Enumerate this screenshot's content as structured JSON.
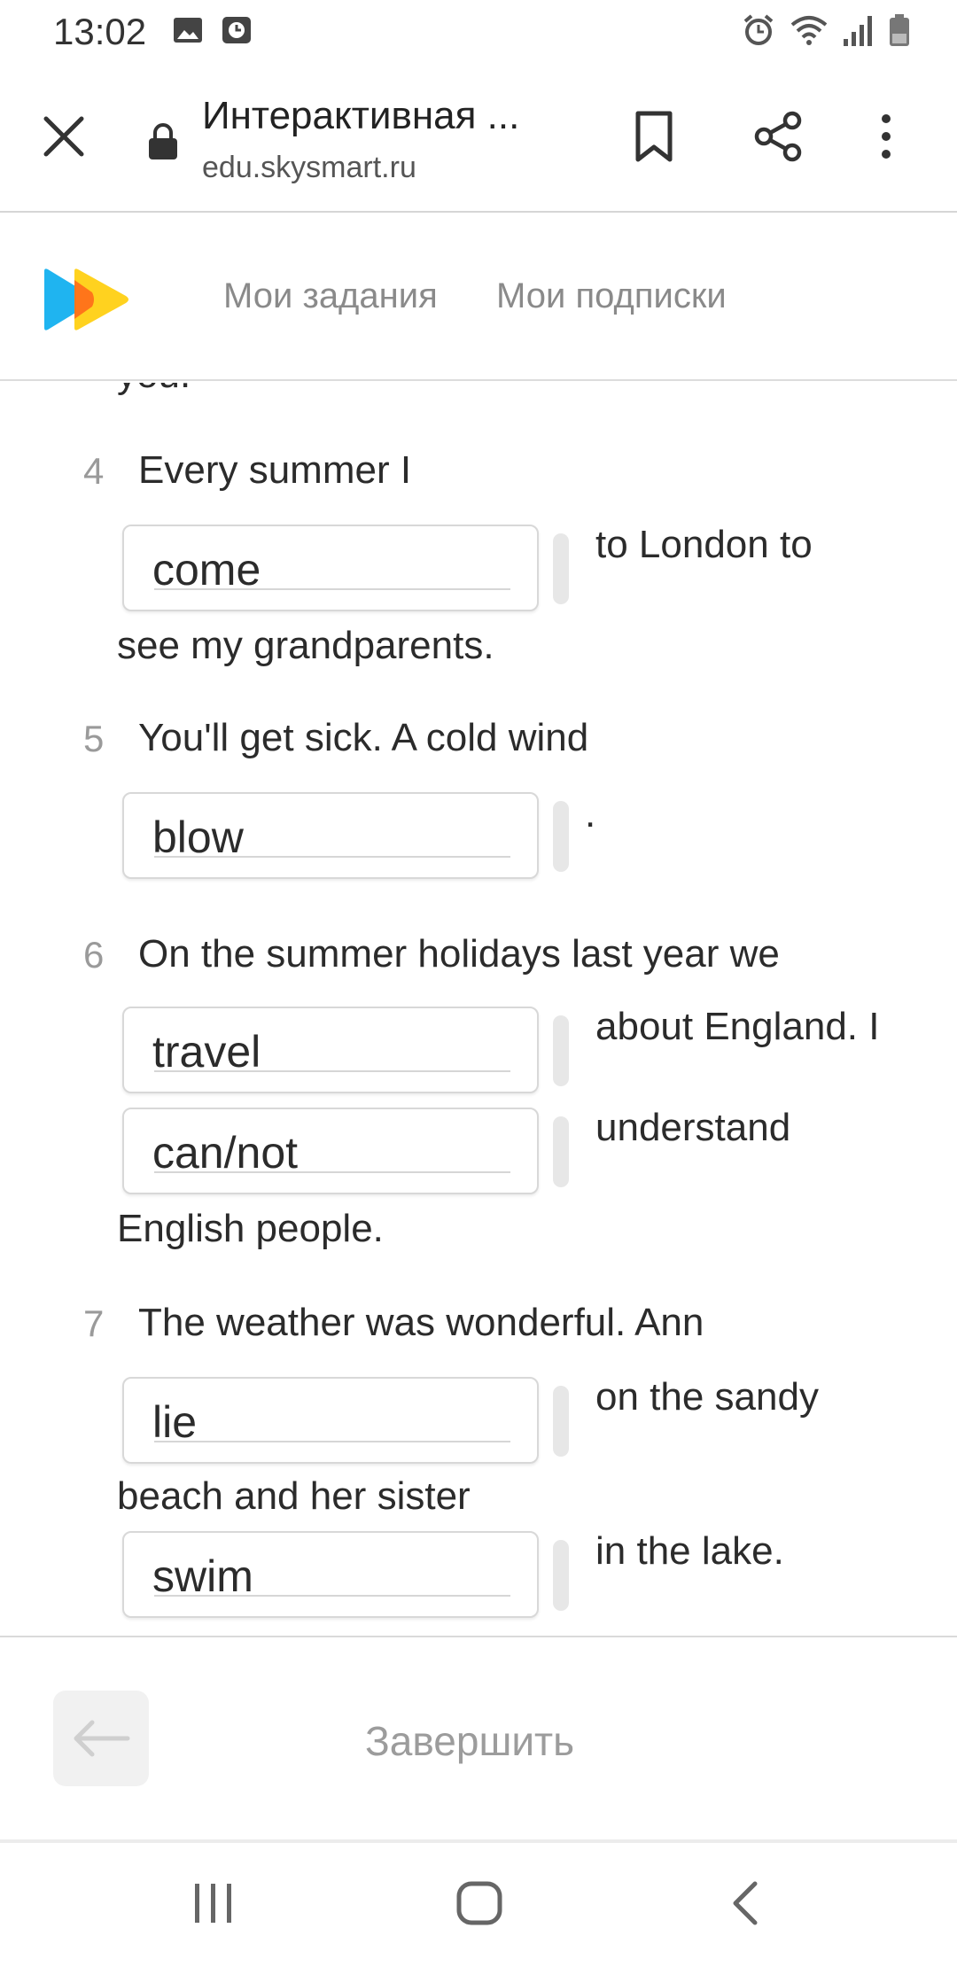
{
  "status_bar": {
    "time": "13:02",
    "left_icons": [
      "image-icon",
      "clock-icon"
    ],
    "right_icons": [
      "alarm-icon",
      "wifi-icon",
      "signal-icon",
      "battery-icon"
    ]
  },
  "browser": {
    "title": "Интерактивная ...",
    "url": "edu.skysmart.ru",
    "icons": [
      "close-icon",
      "lock-icon",
      "bookmark-icon",
      "share-icon",
      "more-vert-icon"
    ]
  },
  "site_header": {
    "nav": [
      "Мои задания",
      "Мои подписки"
    ]
  },
  "exercise": {
    "prev_tail": "you.",
    "items": [
      {
        "number": "4",
        "text_before": "Every summer I",
        "answers": [
          "come"
        ],
        "text_after_1": "to London to",
        "text_end": "see my grandparents."
      },
      {
        "number": "5",
        "text_before": "You'll get sick. A cold wind",
        "answers": [
          "blow"
        ],
        "text_after_1": "."
      },
      {
        "number": "6",
        "text_before": "On the summer holidays last year we",
        "answers": [
          "travel",
          "can/not"
        ],
        "text_after_1": "about England. I",
        "text_after_2": "understand",
        "text_end": "English people."
      },
      {
        "number": "7",
        "text_before": "The weather was wonderful. Ann",
        "answers": [
          "lie",
          "swim"
        ],
        "text_after_1": "on the sandy",
        "text_middle": "beach and her sister",
        "text_after_2": "in the lake."
      }
    ]
  },
  "bottom_bar": {
    "finish_label": "Завершить"
  },
  "colors": {
    "logo_blue": "#1fb4f0",
    "logo_yellow": "#ffd21f",
    "logo_orange": "#ff6a1a"
  }
}
